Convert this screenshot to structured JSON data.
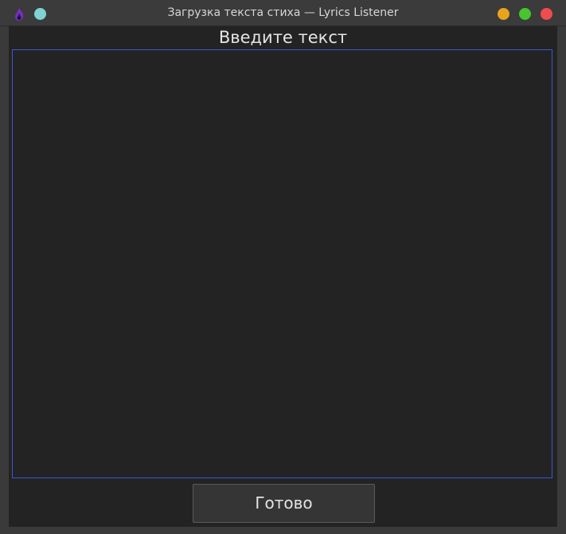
{
  "window": {
    "title": "Загрузка текста стиха — Lyrics Listener",
    "controls": {
      "pin_color": "#7fd3d0",
      "minimize_color": "#e8a41c",
      "maximize_color": "#46c52e",
      "close_color": "#f04b4f"
    },
    "app_icon": "flame-icon"
  },
  "main": {
    "heading": "Введите текст",
    "text_input": {
      "value": "",
      "placeholder": "",
      "border_color": "#3f56d6"
    },
    "done_button_label": "Готово"
  }
}
